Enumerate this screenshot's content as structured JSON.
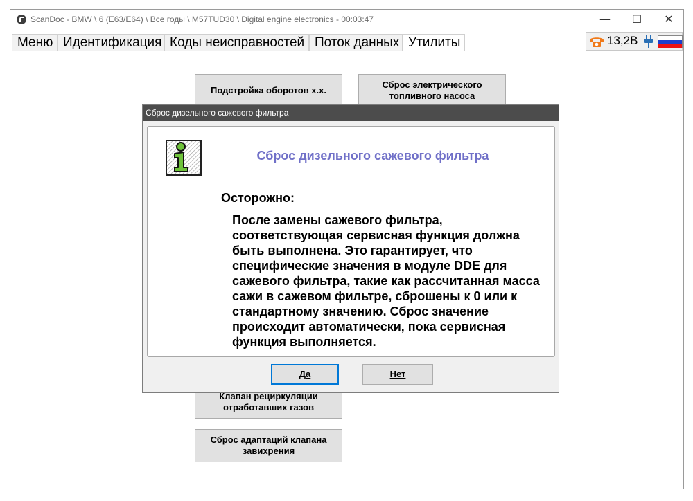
{
  "window": {
    "title": "ScanDoc - BMW \\ 6 (E63/E64) \\ Все годы \\ M57TUD30 \\ Digital engine electronics - 00:03:47",
    "minimize_glyph": "—",
    "maximize_glyph": "☐",
    "close_glyph": "✕"
  },
  "menu": {
    "tabs": [
      "Меню",
      "Идентификация",
      "Коды неисправностей",
      "Поток данных",
      "Утилиты"
    ],
    "active_index": 4
  },
  "status": {
    "voltage": "13,2В",
    "icons": [
      "phone-icon",
      "plug-icon",
      "russia-flag-icon"
    ],
    "phone_color": "#f07a1a"
  },
  "utilities": {
    "buttons": [
      "Подстройка оборотов х.х.",
      "Сброс электрического топливного насоса",
      "Клапан рециркуляции отработавших газов",
      "Сброс адаптаций клапана завихрения"
    ]
  },
  "dialog": {
    "title": "Сброс дизельного сажевого фильтра",
    "heading": "Сброс дизельного сажевого фильтра",
    "heading_color": "#7070c8",
    "caution": "Осторожно:",
    "body": "После замены сажевого фильтра, соответствующая сервисная функция должна быть выполнена. Это гарантирует, что специфические значения в модуле DDE для сажевого фильтра, такие как рассчитанная масса сажи в сажевом фильтре, сброшены к 0 или к стандартному значению. Сброс значение происходит автоматически, пока сервисная функция выполняется.",
    "yes_label": "Да",
    "no_label": "Нет",
    "icon": "info-icon"
  }
}
